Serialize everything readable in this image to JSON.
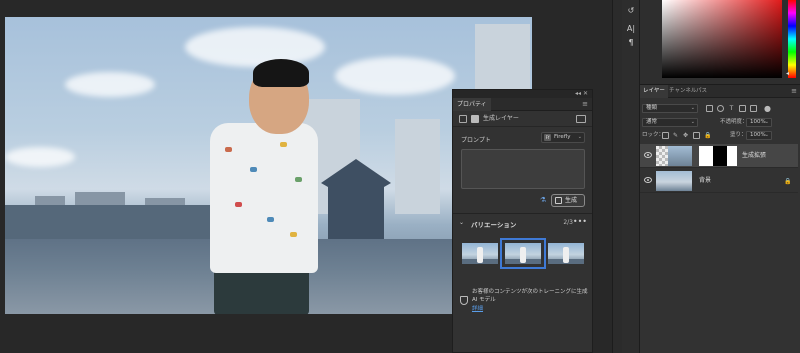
{
  "properties_panel": {
    "top_controls": "◂◂  ✕",
    "tab_label": "プロパティ",
    "menu_icon": "hamburger-icon",
    "layer_type_label": "生成レイヤー",
    "prompt_label": "プロンプト",
    "model_dropdown": "Firefly",
    "model_badge": "Ff",
    "prompt_value": "",
    "generate_button": "生成",
    "variations_title": "バリエーション",
    "variations_count": "2/3",
    "variations_more": "•••",
    "notice_text": "お客様のコンテンツが次のトレーニングに生成 AI モデル",
    "notice_link": "詳細"
  },
  "layers_panel": {
    "tabs": [
      "レイヤー",
      "チャンネル",
      "パス"
    ],
    "filter_kind": "種類",
    "blend_mode": "通常",
    "opacity_label": "不透明度：",
    "opacity_value": "100%",
    "lock_label": "ロック：",
    "fill_label": "塗り：",
    "fill_value": "100%",
    "layers": [
      {
        "name": "生成拡張",
        "selected": true
      },
      {
        "name": "背景",
        "selected": false
      }
    ]
  },
  "colors": {
    "accent": "#3f7ad6",
    "link": "#5a9de8",
    "panel_bg": "#323232",
    "app_bg": "#282828"
  }
}
